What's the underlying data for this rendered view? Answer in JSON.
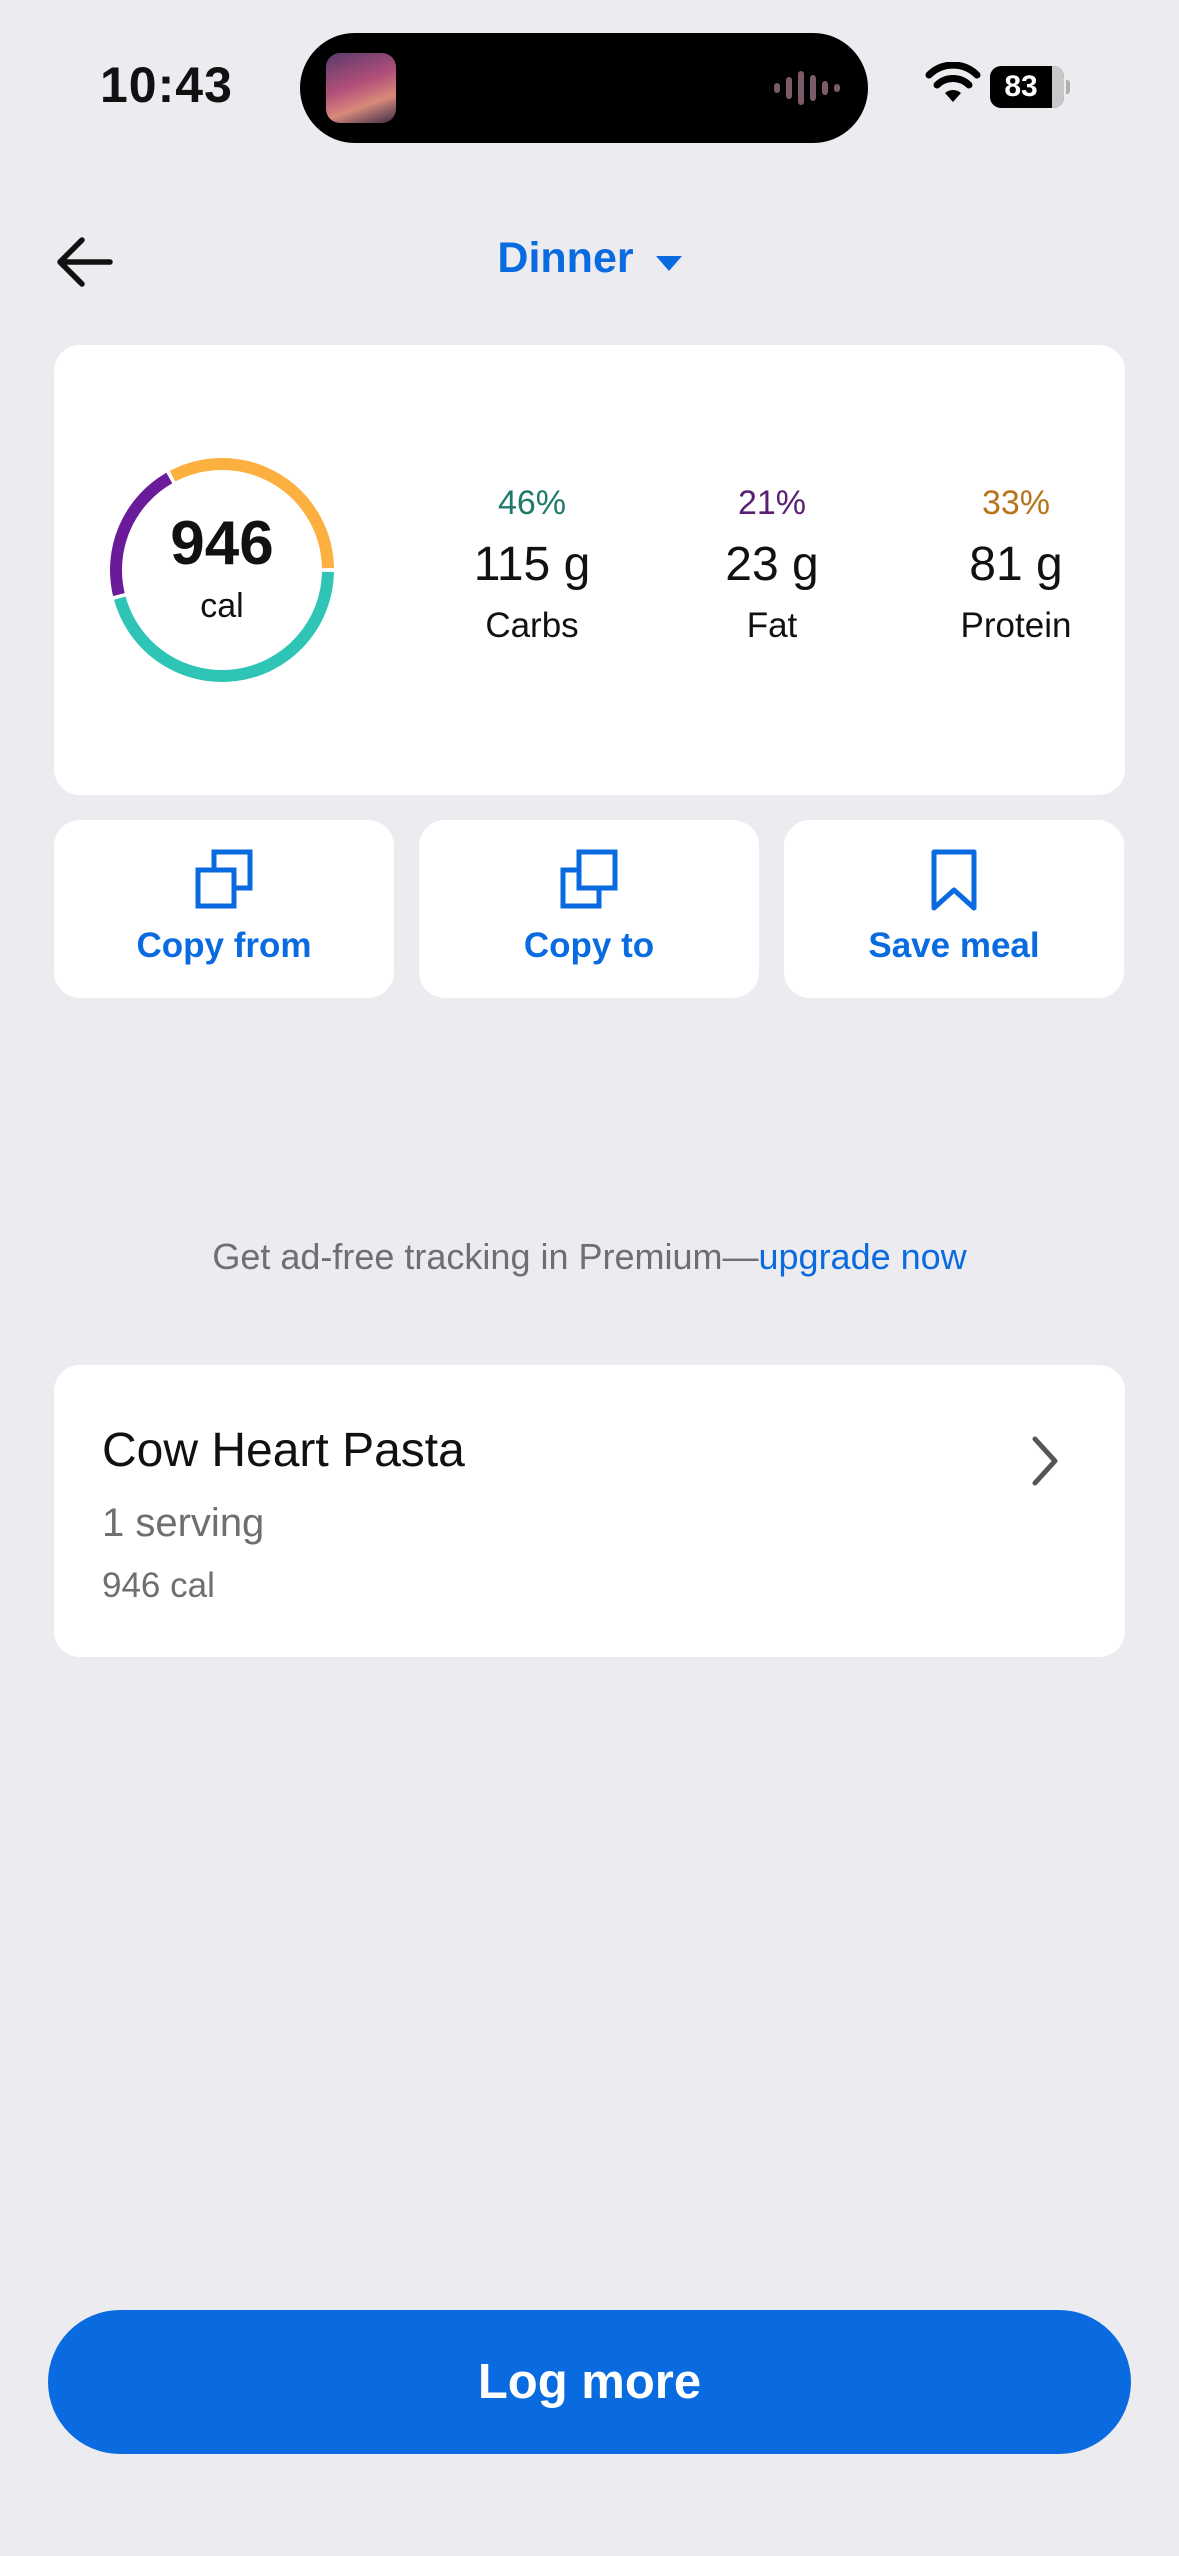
{
  "status_bar": {
    "time": "10:43",
    "battery": "83"
  },
  "header": {
    "meal": "Dinner"
  },
  "summary": {
    "calories": "946",
    "calories_unit": "cal",
    "ring": {
      "carbs_pct": 46,
      "fat_pct": 21,
      "protein_pct": 33
    },
    "macros": [
      {
        "pct": "46%",
        "grams": "115 g",
        "label": "Carbs",
        "color": "#1F7A6C"
      },
      {
        "pct": "21%",
        "grams": "23 g",
        "label": "Fat",
        "color": "#5A1E72"
      },
      {
        "pct": "33%",
        "grams": "81 g",
        "label": "Protein",
        "color": "#B7741A"
      }
    ],
    "colors": {
      "carbs": "#2EC4B6",
      "fat": "#6A1B9A",
      "protein": "#FBB040"
    }
  },
  "actions": [
    {
      "label": "Copy from",
      "icon": "copy-icon"
    },
    {
      "label": "Copy to",
      "icon": "copy-icon"
    },
    {
      "label": "Save meal",
      "icon": "bookmark-icon"
    }
  ],
  "promo": {
    "text": "Get ad-free tracking in Premium—",
    "link": "upgrade now"
  },
  "food_item": {
    "name": "Cow Heart Pasta",
    "serving": "1 serving",
    "calories": "946 cal"
  },
  "log_more_label": "Log more",
  "accent": "#0A6BE0"
}
